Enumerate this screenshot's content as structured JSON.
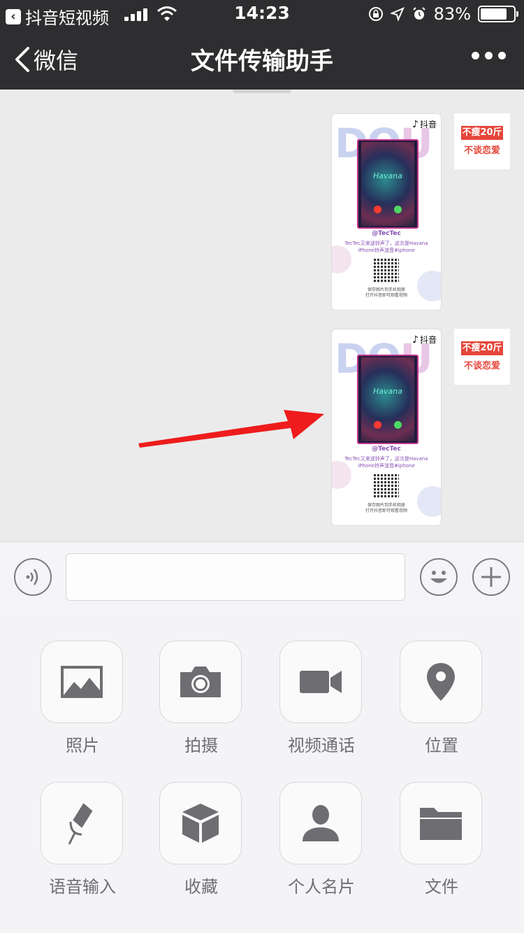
{
  "status_bar": {
    "back_app": "抖音短视频",
    "time": "14:23",
    "battery": "83%",
    "battery_level": 0.83
  },
  "nav": {
    "back_label": "微信",
    "title": "文件传输助手"
  },
  "messages": [
    {
      "brand": "抖音",
      "handle": "@TecTec",
      "line1": "TecTec又来送铃声了，这次是Havana",
      "line2": "iPhone铃声渲音#iphone",
      "save_line1": "保存图片到手机相册",
      "save_line2": "打开抖音即可观看视频",
      "screen_title": "Havana",
      "avatar_line1": "不瘦20斤",
      "avatar_line2": "不谈恋爱"
    },
    {
      "brand": "抖音",
      "handle": "@TecTec",
      "line1": "TecTec又来送铃声了，这次是Havana",
      "line2": "iPhone铃声渲音#iphone",
      "save_line1": "保存图片到手机相册",
      "save_line2": "打开抖音即可观看视频",
      "screen_title": "Havana",
      "avatar_line1": "不瘦20斤",
      "avatar_line2": "不谈恋爱"
    }
  ],
  "panel": {
    "items": [
      {
        "label": "照片",
        "icon": "photo-icon"
      },
      {
        "label": "拍摄",
        "icon": "camera-icon"
      },
      {
        "label": "视频通话",
        "icon": "video-call-icon"
      },
      {
        "label": "位置",
        "icon": "location-icon"
      },
      {
        "label": "语音输入",
        "icon": "microphone-icon"
      },
      {
        "label": "收藏",
        "icon": "favorites-box-icon"
      },
      {
        "label": "个人名片",
        "icon": "contact-card-icon"
      },
      {
        "label": "文件",
        "icon": "folder-icon"
      }
    ]
  },
  "colors": {
    "nav_bg": "#2e2e30",
    "chat_bg": "#ebebeb",
    "annotation_arrow": "#ee1c1c",
    "icon_gray": "#6e6e72"
  }
}
